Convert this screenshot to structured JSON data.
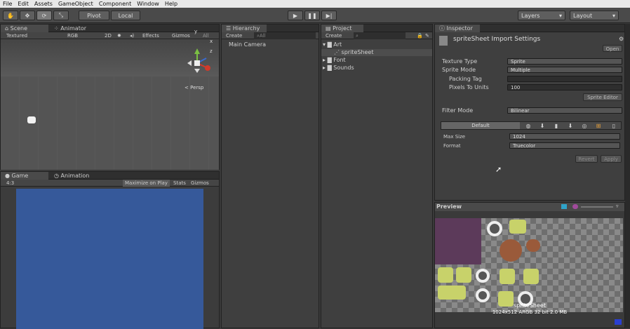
{
  "menu": [
    "File",
    "Edit",
    "Assets",
    "GameObject",
    "Component",
    "Window",
    "Help"
  ],
  "toolbar": {
    "pivot": "Pivot",
    "local": "Local",
    "layers": "Layers",
    "layout": "Layout"
  },
  "scene": {
    "tab_scene": "Scene",
    "tab_animator": "Animator",
    "shading": "Textured",
    "render": "RGB",
    "mode2d": "2D",
    "effects": "Effects",
    "gizmos": "Gizmos",
    "search": "All",
    "persp": "Persp",
    "axis_y": "y",
    "axis_x": "x",
    "axis_z": "z"
  },
  "game": {
    "tab_game": "Game",
    "tab_animation": "Animation",
    "aspect": "4:3",
    "maximize": "Maximize on Play",
    "stats": "Stats",
    "gizmos": "Gizmos"
  },
  "hierarchy": {
    "tab": "Hierarchy",
    "create": "Create",
    "search": "All",
    "items": [
      "Main Camera"
    ]
  },
  "project": {
    "tab": "Project",
    "create": "Create",
    "folder_art": "Art",
    "item_spritesheet": "spriteSheet",
    "folder_font": "Font",
    "folder_sounds": "Sounds"
  },
  "inspector": {
    "tab": "Inspector",
    "title": "spriteSheet Import Settings",
    "open": "Open",
    "texture_type_label": "Texture Type",
    "texture_type": "Sprite",
    "sprite_mode_label": "Sprite Mode",
    "sprite_mode": "Multiple",
    "packing_tag_label": "Packing Tag",
    "packing_tag": "",
    "ppu_label": "Pixels To Units",
    "ppu": "100",
    "sprite_editor": "Sprite Editor",
    "filter_mode_label": "Filter Mode",
    "filter_mode": "Bilinear",
    "default": "Default",
    "max_size_label": "Max Size",
    "max_size": "1024",
    "format_label": "Format",
    "format": "Truecolor",
    "revert": "Revert",
    "apply": "Apply"
  },
  "preview": {
    "title": "Preview",
    "name": "spriteSheet",
    "info": "1024x512  ARGB 32 bit  2.0 MB"
  },
  "colors": {
    "game_bg": "#36599a",
    "checker_light": "#8a8a8a",
    "checker_dark": "#6e6e6e"
  }
}
